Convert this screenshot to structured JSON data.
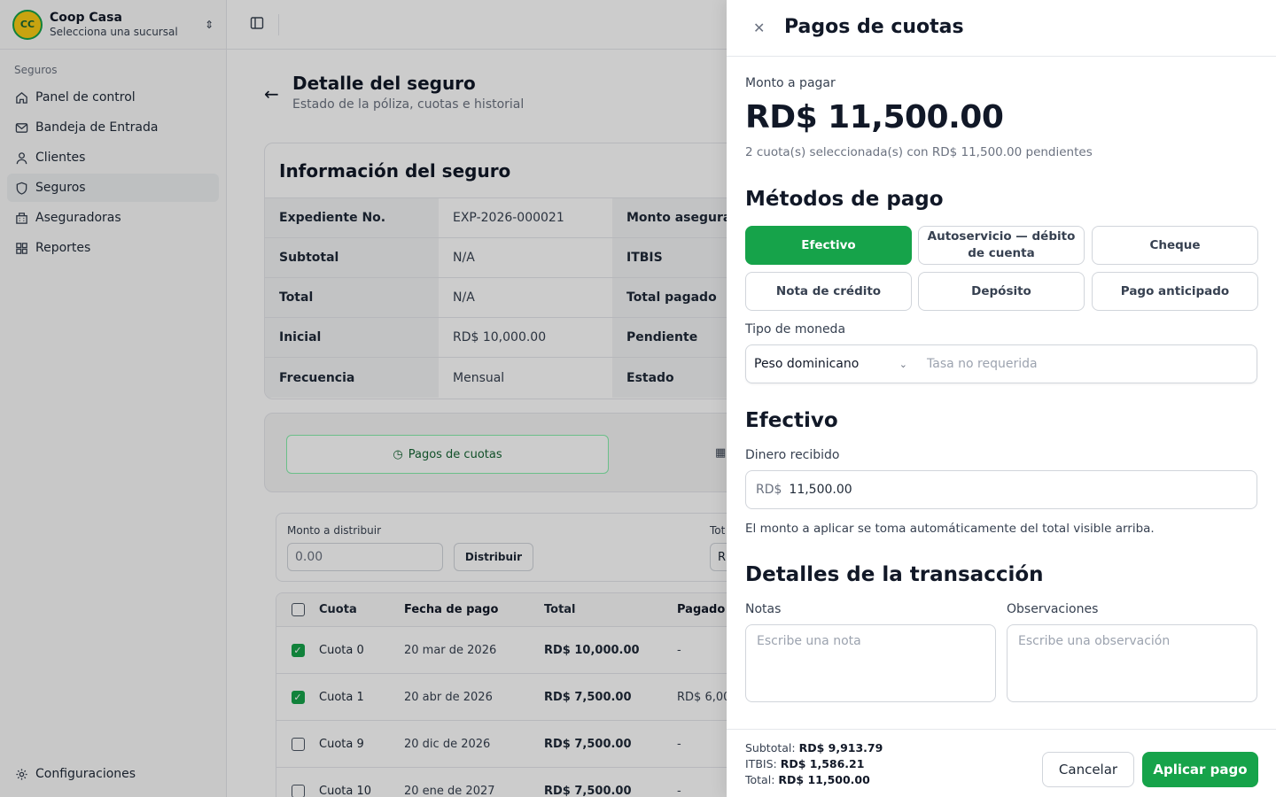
{
  "brand": {
    "name": "Coop Casa",
    "subtitle": "Selecciona una sucursal",
    "logo_text": "CC"
  },
  "sidebar": {
    "group": "Seguros",
    "items": [
      {
        "label": "Panel de control",
        "icon": "home-icon"
      },
      {
        "label": "Bandeja de Entrada",
        "icon": "mail-icon"
      },
      {
        "label": "Clientes",
        "icon": "user-icon"
      },
      {
        "label": "Seguros",
        "icon": "shield-icon",
        "active": true
      },
      {
        "label": "Aseguradoras",
        "icon": "building-icon"
      },
      {
        "label": "Reportes",
        "icon": "grid-icon"
      }
    ],
    "settings_label": "Configuraciones"
  },
  "page": {
    "title": "Detalle del seguro",
    "subtitle": "Estado de la póliza, cuotas e historial"
  },
  "info": {
    "title": "Información del seguro",
    "rows": [
      {
        "k": "Expediente No.",
        "v": "EXP-2026-000021",
        "k2": "Monto asegurado"
      },
      {
        "k": "Subtotal",
        "v": "N/A",
        "k2": "ITBIS"
      },
      {
        "k": "Total",
        "v": "N/A",
        "k2": "Total pagado"
      },
      {
        "k": "Inicial",
        "v": "RD$ 10,000.00",
        "k2": "Pendiente"
      },
      {
        "k": "Frecuencia",
        "v": "Mensual",
        "k2": "Estado"
      }
    ]
  },
  "tabs": {
    "active": "Pagos de cuotas"
  },
  "distribute": {
    "label": "Monto a distribuir",
    "placeholder": "0.00",
    "button": "Distribuir",
    "total_label": "Tot",
    "total_value": "R"
  },
  "cuotas": {
    "headers": [
      "Cuota",
      "Fecha de pago",
      "Total",
      "Pagado"
    ],
    "rows": [
      {
        "cuota": "Cuota 0",
        "fecha": "20 mar de 2026",
        "total": "RD$ 10,000.00",
        "pagado": "-",
        "checked": true
      },
      {
        "cuota": "Cuota 1",
        "fecha": "20 abr de 2026",
        "total": "RD$ 7,500.00",
        "pagado": "RD$ 6,00",
        "checked": true
      },
      {
        "cuota": "Cuota 9",
        "fecha": "20 dic de 2026",
        "total": "RD$ 7,500.00",
        "pagado": "-",
        "checked": false
      },
      {
        "cuota": "Cuota 10",
        "fecha": "20 ene de 2027",
        "total": "RD$ 7,500.00",
        "pagado": "-",
        "checked": false
      }
    ]
  },
  "drawer": {
    "title": "Pagos de cuotas",
    "amount_label": "Monto a pagar",
    "amount": "RD$ 11,500.00",
    "amount_sub": "2 cuota(s) seleccionada(s) con RD$ 11,500.00 pendientes",
    "methods_title": "Métodos de pago",
    "methods": [
      "Efectivo",
      "Autoservicio — débito de cuenta",
      "Cheque",
      "Nota de crédito",
      "Depósito",
      "Pago anticipado"
    ],
    "currency_label": "Tipo de moneda",
    "currency_value": "Peso dominicano",
    "rate_placeholder": "Tasa no requerida",
    "cash_title": "Efectivo",
    "received_label": "Dinero recibido",
    "received_prefix": "RD$",
    "received_value": "11,500.00",
    "help": "El monto a aplicar se toma automáticamente del total visible arriba.",
    "details_title": "Detalles de la transacción",
    "notes_label": "Notas",
    "notes_placeholder": "Escribe una nota",
    "obs_label": "Observaciones",
    "obs_placeholder": "Escribe una observación",
    "subtotal_label": "Subtotal:",
    "subtotal": "RD$ 9,913.79",
    "itbis_label": "ITBIS:",
    "itbis": "RD$ 1,586.21",
    "total_label": "Total:",
    "total": "RD$ 11,500.00",
    "cancel": "Cancelar",
    "apply": "Aplicar pago"
  },
  "colors": {
    "accent": "#16a34a",
    "overlay": "rgba(0,0,0,0.2)"
  }
}
